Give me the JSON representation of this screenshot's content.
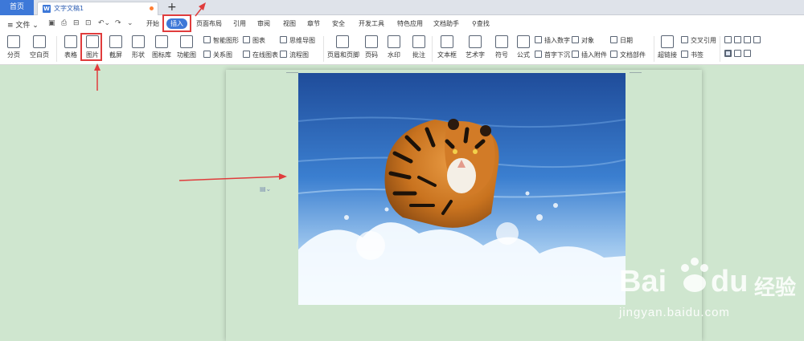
{
  "tabbar": {
    "home": "首页",
    "doc_tab": "文字文稿1",
    "add": "+"
  },
  "menubar": {
    "file": "≡ 文件 ⌄",
    "tabs": [
      "开始",
      "插入",
      "页面布局",
      "引用",
      "审阅",
      "视图",
      "章节",
      "安全",
      "开发工具",
      "特色应用",
      "文档助手"
    ],
    "active_tab": "插入",
    "search": "查找"
  },
  "ribbon": {
    "large_buttons": [
      "分页",
      "空白页",
      "表格",
      "图片",
      "截屏",
      "形状",
      "图标库",
      "功能图",
      "页眉和页脚",
      "页码",
      "水印",
      "批注",
      "文本框",
      "艺术字",
      "符号",
      "公式",
      "超链接"
    ],
    "small_buttons": [
      "智能图形",
      "关系图",
      "图表",
      "在线图表",
      "思维导图",
      "流程图",
      "插入数字",
      "首字下沉",
      "对象",
      "插入附件",
      "日期",
      "文档部件",
      "交叉引用",
      "书签"
    ]
  },
  "document": {
    "image": "tiger-running-in-water-photo"
  },
  "watermark": {
    "brand": "Bai",
    "brand2": "du",
    "cn": "经验",
    "url": "jingyan.baidu.com"
  },
  "colors": {
    "accent": "#3d78d8",
    "highlight": "#e03c3c",
    "page_bg": "#cfe6cf"
  }
}
